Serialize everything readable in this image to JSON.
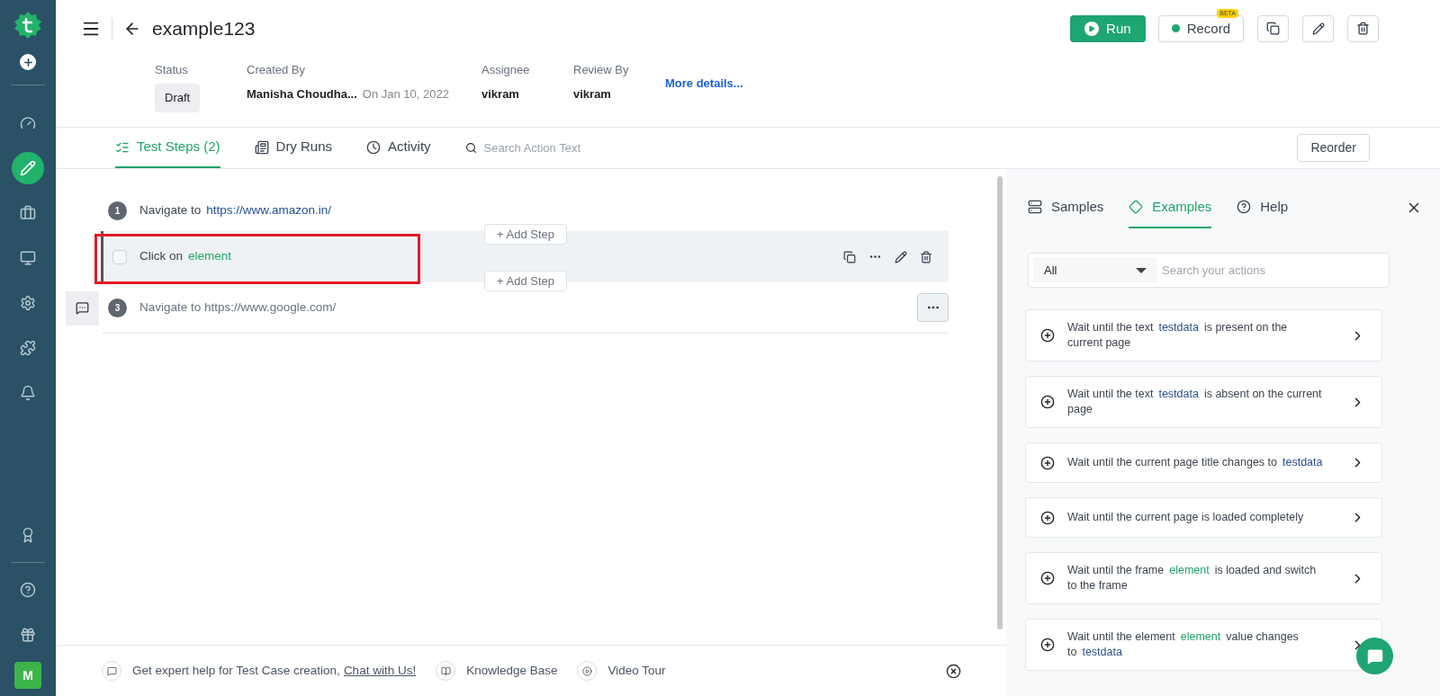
{
  "sidebar": {
    "items": [
      {
        "selected": false
      },
      {
        "selected": true
      },
      {
        "selected": false
      },
      {
        "selected": false
      },
      {
        "selected": false
      },
      {
        "selected": false
      },
      {
        "selected": false
      }
    ],
    "bottom_items": [
      {
        "selected": false
      },
      {
        "selected": false
      },
      {
        "selected": false
      }
    ],
    "avatar": "M"
  },
  "header": {
    "title": "example123",
    "run_button": "Run",
    "record_button": "Record",
    "beta_badge": "BETA"
  },
  "details": [
    {
      "label": "Status",
      "value": "Draft",
      "kind": "badge"
    },
    {
      "label": "Created By",
      "value": "Manisha Choudha...",
      "extra": "On Jan 10, 2022",
      "kind": "text"
    },
    {
      "label": "Assignee",
      "value": "vikram",
      "kind": "text"
    },
    {
      "label": "Review By",
      "value": "vikram",
      "kind": "text"
    }
  ],
  "more_link": "More details...",
  "tabs": [
    {
      "label": "Test Steps (2)",
      "selected": true
    },
    {
      "label": "Dry Runs",
      "selected": false
    },
    {
      "label": "Activity",
      "selected": false
    }
  ],
  "search_placeholder": "Search Action Text",
  "reorder_button": "Reorder",
  "steps": [
    {
      "kind": "numbered",
      "number": "1",
      "selected": false,
      "parts": [
        {
          "text": "Navigate to",
          "kind": "plain"
        },
        {
          "text": "https://www.amazon.in/",
          "kind": "url"
        }
      ]
    },
    {
      "kind": "checkbox",
      "checked": false,
      "selected": true,
      "parts": [
        {
          "text": "Click on",
          "kind": "plain"
        },
        {
          "text": "element",
          "kind": "element"
        }
      ]
    },
    {
      "kind": "numbered",
      "number": "3",
      "selected": false,
      "parts": [
        {
          "text": "Navigate to https://www.google.com/",
          "kind": "muted"
        }
      ]
    }
  ],
  "add_step_buttons": [
    "+ Add Step",
    "+ Add Step"
  ],
  "panel": {
    "tabs": [
      {
        "label": "Samples",
        "selected": false
      },
      {
        "label": "Examples",
        "selected": true
      },
      {
        "label": "Help",
        "selected": false
      }
    ],
    "filter": "All",
    "search_placeholder": "Search your actions",
    "examples": [
      {
        "parts": [
          {
            "text": "Wait until the text",
            "kind": "plain"
          },
          {
            "text": "testdata",
            "kind": "testdata"
          },
          {
            "text": "is present on the current page",
            "kind": "plain"
          }
        ]
      },
      {
        "parts": [
          {
            "text": "Wait until the text",
            "kind": "plain"
          },
          {
            "text": "testdata",
            "kind": "testdata"
          },
          {
            "text": "is absent on the current page",
            "kind": "plain"
          }
        ]
      },
      {
        "parts": [
          {
            "text": "Wait until the current page title changes to",
            "kind": "plain"
          },
          {
            "text": "testdata",
            "kind": "testdata"
          }
        ]
      },
      {
        "parts": [
          {
            "text": "Wait until the current page is loaded completely",
            "kind": "plain"
          }
        ]
      },
      {
        "parts": [
          {
            "text": "Wait until the frame",
            "kind": "plain"
          },
          {
            "text": "element",
            "kind": "element"
          },
          {
            "text": "is loaded and switch to the frame",
            "kind": "plain"
          }
        ]
      },
      {
        "parts": [
          {
            "text": "Wait until the element",
            "kind": "plain"
          },
          {
            "text": "element",
            "kind": "element"
          },
          {
            "text": "value changes to",
            "kind": "plain"
          },
          {
            "text": "testdata",
            "kind": "testdata"
          }
        ]
      }
    ]
  },
  "footer": {
    "help_text": "Get expert help for Test Case creation,",
    "chat_link": "Chat with Us!",
    "knowledge_base": "Knowledge Base",
    "video_tour": "Video Tour"
  }
}
